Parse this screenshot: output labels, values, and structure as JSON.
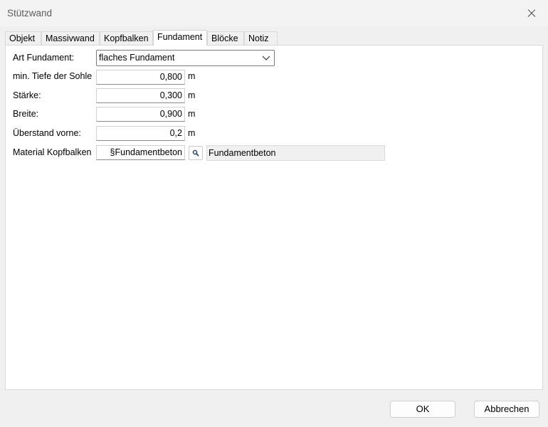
{
  "window": {
    "title": "Stützwand"
  },
  "tabs": [
    "Objekt",
    "Massivwand",
    "Kopfbalken",
    "Fundament",
    "Blöcke",
    "Notiz"
  ],
  "active_tab": "Fundament",
  "form": {
    "art_fundament": {
      "label": "Art Fundament:",
      "value": "flaches Fundament"
    },
    "tiefe": {
      "label": "min. Tiefe der Sohle",
      "value": "0,800",
      "unit": "m"
    },
    "staerke": {
      "label": "Stärke:",
      "value": "0,300",
      "unit": "m"
    },
    "breite": {
      "label": "Breite:",
      "value": "0,900",
      "unit": "m"
    },
    "ueberstand": {
      "label": "Überstand vorne:",
      "value": "0,2",
      "unit": "m"
    },
    "material": {
      "label": "Material Kopfbalken",
      "value": "§Fundamentbeton",
      "display": "Fundamentbeton"
    }
  },
  "buttons": {
    "ok": "OK",
    "cancel": "Abbrechen"
  },
  "icons": {
    "close": "close-icon",
    "browse": "magnifier-icon",
    "dropdown": "chevron-down-icon"
  }
}
